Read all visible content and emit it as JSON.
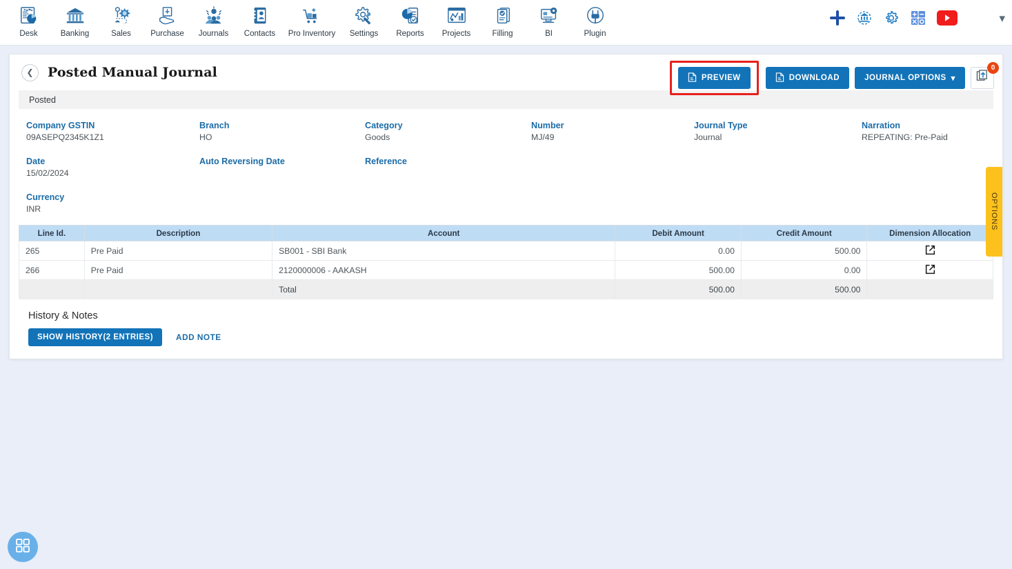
{
  "nav": {
    "items": [
      {
        "label": "Desk",
        "icon": "dashboard-icon"
      },
      {
        "label": "Banking",
        "icon": "bank-icon"
      },
      {
        "label": "Sales",
        "icon": "sales-icon"
      },
      {
        "label": "Purchase",
        "icon": "purchase-icon"
      },
      {
        "label": "Journals",
        "icon": "journals-icon"
      },
      {
        "label": "Contacts",
        "icon": "contacts-icon"
      },
      {
        "label": "Pro Inventory",
        "icon": "inventory-icon"
      },
      {
        "label": "Settings",
        "icon": "settings-icon"
      },
      {
        "label": "Reports",
        "icon": "reports-icon"
      },
      {
        "label": "Projects",
        "icon": "projects-icon"
      },
      {
        "label": "Filling",
        "icon": "filling-icon"
      },
      {
        "label": "BI",
        "icon": "bi-icon"
      },
      {
        "label": "Plugin",
        "icon": "plugin-icon"
      }
    ],
    "right_icons": [
      {
        "name": "add-icon"
      },
      {
        "name": "bank-sync-icon"
      },
      {
        "name": "gear-icon"
      },
      {
        "name": "calculator-icon"
      },
      {
        "name": "youtube-icon"
      },
      {
        "name": "chevron-down-icon"
      }
    ]
  },
  "header": {
    "back_icon": "chevron-left-icon",
    "title": "Posted Manual Journal",
    "preview_label": "PREVIEW",
    "download_label": "DOWNLOAD",
    "journal_options_label": "JOURNAL OPTIONS",
    "journal_options_caret": "▾",
    "upload_icon": "upload-documents-icon",
    "upload_badge": "0"
  },
  "status": {
    "text": "Posted"
  },
  "details": {
    "fields": [
      {
        "label": "Company GSTIN",
        "value": "09ASEPQ2345K1Z1"
      },
      {
        "label": "Branch",
        "value": "HO"
      },
      {
        "label": "Category",
        "value": "Goods"
      },
      {
        "label": "Number",
        "value": "MJ/49"
      },
      {
        "label": "Journal Type",
        "value": "Journal"
      },
      {
        "label": "Narration",
        "value": "REPEATING: Pre-Paid"
      },
      {
        "label": "Date",
        "value": "15/02/2024"
      },
      {
        "label": "Auto Reversing Date",
        "value": ""
      },
      {
        "label": "Reference",
        "value": ""
      },
      {
        "label": "",
        "value": ""
      },
      {
        "label": "",
        "value": ""
      },
      {
        "label": "",
        "value": ""
      },
      {
        "label": "Currency",
        "value": "INR"
      },
      {
        "label": "",
        "value": ""
      },
      {
        "label": "",
        "value": ""
      },
      {
        "label": "",
        "value": ""
      },
      {
        "label": "",
        "value": ""
      },
      {
        "label": "",
        "value": ""
      }
    ]
  },
  "table": {
    "columns": [
      "Line Id.",
      "Description",
      "Account",
      "Debit Amount",
      "Credit Amount",
      "Dimension Allocation"
    ],
    "rows": [
      {
        "line_id": "265",
        "description": "Pre Paid",
        "account": "SB001 - SBI Bank",
        "debit": "0.00",
        "credit": "500.00",
        "dimension_icon": "external-link-icon"
      },
      {
        "line_id": "266",
        "description": "Pre Paid",
        "account": "2120000006 - AAKASH",
        "debit": "500.00",
        "credit": "0.00",
        "dimension_icon": "external-link-icon"
      }
    ],
    "total": {
      "line_id": "",
      "description": "",
      "account": "Total",
      "debit": "500.00",
      "credit": "500.00"
    }
  },
  "history": {
    "title": "History & Notes",
    "show_history_label": "SHOW HISTORY(2 ENTRIES)",
    "add_note_label": "ADD NOTE"
  },
  "options_tab": {
    "label": "OPTIONS"
  },
  "fab": {
    "icon": "apps-grid-icon"
  },
  "colors": {
    "primary": "#1273b8",
    "link": "#1b6ca8",
    "table_header": "#bfdcf5",
    "highlight_outline": "#e8201a",
    "options_tab": "#fcc11d",
    "badge": "#ea4511",
    "page_bg": "#e9eef8"
  }
}
